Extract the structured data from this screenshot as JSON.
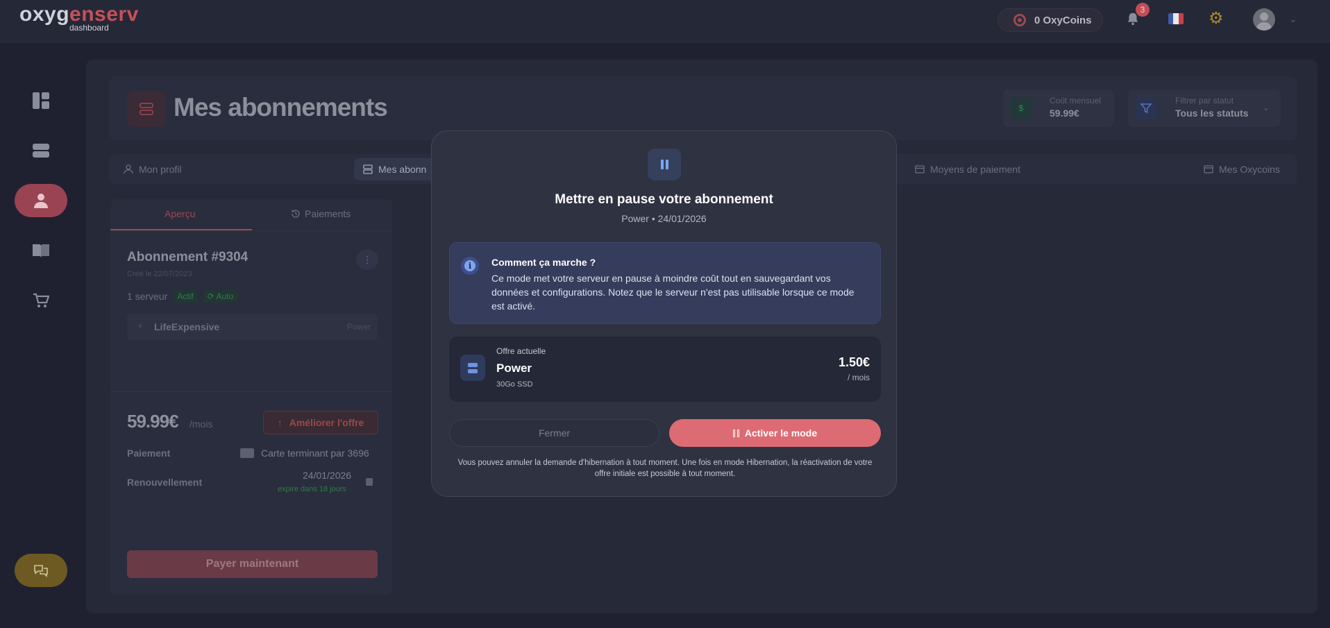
{
  "topbar": {
    "logo_part1": "oxyg",
    "logo_part2": "en",
    "logo_part3": "serv",
    "logo_sub": "dashboard",
    "coins_label": "0 OxyCoins",
    "notifications_count": "3",
    "flag_colors": [
      "#3d5aa8",
      "#e8e8ee",
      "#c8404a"
    ]
  },
  "sidebar": {
    "items": [
      {
        "name": "dashboard-icon"
      },
      {
        "name": "servers-icon"
      },
      {
        "name": "user-icon",
        "active": true
      },
      {
        "name": "book-icon"
      },
      {
        "name": "cart-icon"
      }
    ],
    "chat_icon": "chat-icon"
  },
  "header": {
    "title": "Mes abonnements",
    "monthly_cost_label": "Coût mensuel",
    "monthly_cost_value": "59.99€",
    "filter_label": "Filtrer par statut",
    "filter_value": "Tous les statuts"
  },
  "tabs": [
    {
      "label": "Mon profil"
    },
    {
      "label": "Mes abonn"
    },
    {
      "label": "Moyens de paiement"
    },
    {
      "label": "Mes Oxycoins"
    }
  ],
  "subscription": {
    "sub_tabs": [
      "Aperçu",
      "Paiements"
    ],
    "title": "Abonnement #9304",
    "created": "Créé le 22/07/2023",
    "servers": "1 serveur",
    "status_badge": "Actif",
    "auto_badge": "Auto",
    "server_name": "LifeExpensive",
    "server_plan": "Power",
    "price": "59.99€",
    "price_unit": "/mois",
    "upgrade_label": "Améliorer l'offre",
    "payment_label": "Paiement",
    "payment_value": "Carte terminant par 3696",
    "renewal_label": "Renouvellement",
    "renewal_date": "24/01/2026",
    "renewal_expire": "expire dans 18 jours",
    "pay_now_label": "Payer maintenant"
  },
  "modal": {
    "title": "Mettre en pause votre abonnement",
    "subtitle": "Power • 24/01/2026",
    "info_title": "Comment ça marche ?",
    "info_text": "Ce mode met votre serveur en pause à moindre coût tout en sauvegardant vos données et configurations. Notez que le serveur n'est pas utilisable lorsque ce mode est activé.",
    "offer_label": "Offre actuelle",
    "offer_name": "Power",
    "offer_spec": "30Go SSD",
    "offer_price": "1.50€",
    "offer_per": "/ mois",
    "close_label": "Fermer",
    "activate_label": "Activer le mode",
    "note": "Vous pouvez annuler la demande d'hibernation à tout moment. Une fois en mode Hibernation, la réactivation de votre offre initiale est possible à tout moment."
  }
}
